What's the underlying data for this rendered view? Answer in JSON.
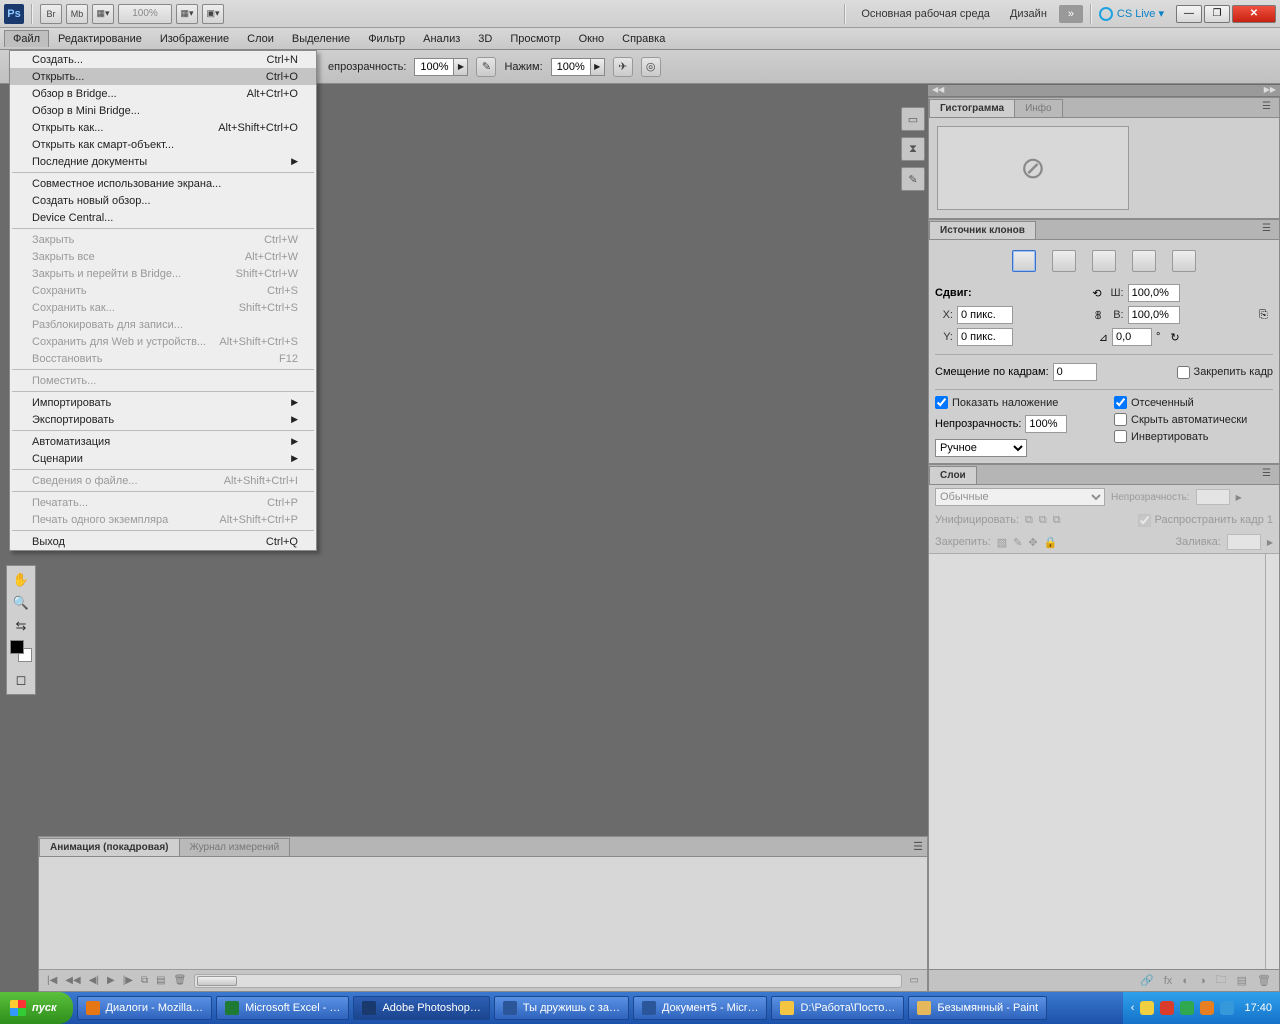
{
  "appbar": {
    "logo": "Ps",
    "br": "Br",
    "mb": "Mb",
    "zoom": "100%",
    "workspace_primary": "Основная рабочая среда",
    "workspace_design": "Дизайн",
    "cs_live": "CS Live ▾"
  },
  "menubar": [
    "Файл",
    "Редактирование",
    "Изображение",
    "Слои",
    "Выделение",
    "Фильтр",
    "Анализ",
    "3D",
    "Просмотр",
    "Окно",
    "Справка"
  ],
  "filemenu": {
    "g1": [
      {
        "l": "Создать...",
        "s": "Ctrl+N"
      },
      {
        "l": "Открыть...",
        "s": "Ctrl+O",
        "hover": true
      },
      {
        "l": "Обзор в Bridge...",
        "s": "Alt+Ctrl+O"
      },
      {
        "l": "Обзор в Mini Bridge..."
      },
      {
        "l": "Открыть как...",
        "s": "Alt+Shift+Ctrl+O"
      },
      {
        "l": "Открыть как смарт-объект..."
      },
      {
        "l": "Последние документы",
        "sub": true
      }
    ],
    "g2": [
      {
        "l": "Совместное использование экрана..."
      },
      {
        "l": "Создать новый обзор..."
      },
      {
        "l": "Device Central..."
      }
    ],
    "g3": [
      {
        "l": "Закрыть",
        "s": "Ctrl+W",
        "dis": true
      },
      {
        "l": "Закрыть все",
        "s": "Alt+Ctrl+W",
        "dis": true
      },
      {
        "l": "Закрыть и перейти в Bridge...",
        "s": "Shift+Ctrl+W",
        "dis": true
      },
      {
        "l": "Сохранить",
        "s": "Ctrl+S",
        "dis": true
      },
      {
        "l": "Сохранить как...",
        "s": "Shift+Ctrl+S",
        "dis": true
      },
      {
        "l": "Разблокировать для записи...",
        "dis": true
      },
      {
        "l": "Сохранить для Web и устройств...",
        "s": "Alt+Shift+Ctrl+S",
        "dis": true
      },
      {
        "l": "Восстановить",
        "s": "F12",
        "dis": true
      }
    ],
    "g4": [
      {
        "l": "Поместить...",
        "dis": true
      }
    ],
    "g5": [
      {
        "l": "Импортировать",
        "sub": true
      },
      {
        "l": "Экспортировать",
        "sub": true
      }
    ],
    "g6": [
      {
        "l": "Автоматизация",
        "sub": true
      },
      {
        "l": "Сценарии",
        "sub": true
      }
    ],
    "g7": [
      {
        "l": "Сведения о файле...",
        "s": "Alt+Shift+Ctrl+I",
        "dis": true
      }
    ],
    "g8": [
      {
        "l": "Печатать...",
        "s": "Ctrl+P",
        "dis": true
      },
      {
        "l": "Печать одного экземпляра",
        "s": "Alt+Shift+Ctrl+P",
        "dis": true
      }
    ],
    "g9": [
      {
        "l": "Выход",
        "s": "Ctrl+Q"
      }
    ]
  },
  "optbar": {
    "opacity_label": "епрозрачность:",
    "opacity_value": "100%",
    "flow_label": "Нажим:",
    "flow_value": "100%"
  },
  "hist_panel": {
    "tab1": "Гистограмма",
    "tab2": "Инфо"
  },
  "clone_panel": {
    "tab": "Источник клонов",
    "shift": "Сдвиг:",
    "x_label": "X:",
    "x_value": "0 пикс.",
    "y_label": "Y:",
    "y_value": "0 пикс.",
    "w_label": "Ш:",
    "w_value": "100,0%",
    "h_label": "В:",
    "h_value": "100,0%",
    "angle_value": "0,0",
    "angle_unit": "°",
    "offset_label": "Смещение по кадрам:",
    "offset_value": "0",
    "lock_frame": "Закрепить кадр",
    "show_overlay": "Показать наложение",
    "clipped": "Отсеченный",
    "opacity_label": "Непрозрачность:",
    "opacity_value": "100%",
    "hide_auto": "Скрыть автоматически",
    "mode": "Ручное",
    "invert": "Инвертировать"
  },
  "layers_panel": {
    "tab": "Слои",
    "blend": "Обычные",
    "opacity_label": "Непрозрачность:",
    "unif": "Унифицировать:",
    "spread": "Распространить кадр 1",
    "lock_label": "Закрепить:",
    "fill_label": "Заливка:"
  },
  "bottom_panel": {
    "tab1": "Анимация (покадровая)",
    "tab2": "Журнал измерений"
  },
  "taskbar": {
    "start": "пуск",
    "items": [
      "Диалоги - Mozilla…",
      "Microsoft Excel - …",
      "Adobe Photoshop…",
      "Ты дружишь с за…",
      "Документ5 - Micr…",
      "D:\\Работа\\Посто…",
      "Безымянный - Paint"
    ],
    "clock": "17:40"
  }
}
